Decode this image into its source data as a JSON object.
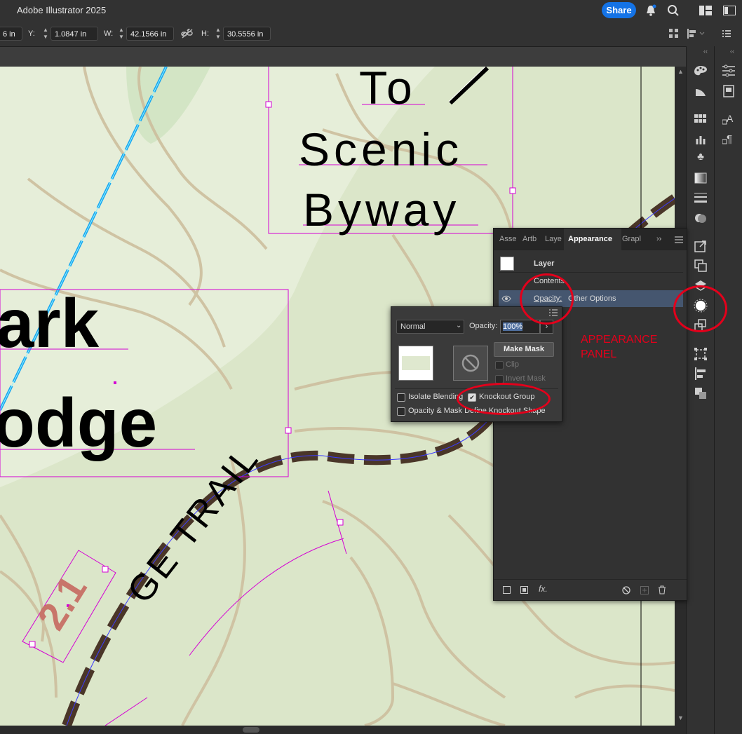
{
  "app": {
    "title": "Adobe Illustrator 2025"
  },
  "titlebar": {
    "share_label": "Share"
  },
  "control_bar": {
    "x_value": "6 in",
    "y_label": "Y:",
    "y_value": "1.0847 in",
    "w_label": "W:",
    "w_value": "42.1566 in",
    "h_label": "H:",
    "h_value": "30.5556 in"
  },
  "map": {
    "label_to": "To",
    "label_scenic": "Scenic",
    "label_byway": "Byway",
    "label_ark": "ark",
    "label_odge": "odge",
    "label_trail": "GE TRAIL",
    "label_number": "2.1"
  },
  "appearance_panel": {
    "tabs": [
      "Asse",
      "Artb",
      "Laye",
      "Appearance",
      "Grapl"
    ],
    "active_tab": "Appearance",
    "layer_label": "Layer",
    "contents_label": "Contents",
    "opacity_label": "Opacity:",
    "opacity_value": "Other Options"
  },
  "transparency_panel": {
    "blend_mode": "Normal",
    "opacity_label": "Opacity:",
    "opacity_value": "100%",
    "make_mask_label": "Make Mask",
    "clip_label": "Clip",
    "invert_mask_label": "Invert Mask",
    "isolate_blending_label": "Isolate Blending",
    "isolate_blending_checked": false,
    "knockout_group_label": "Knockout Group",
    "knockout_group_checked": true,
    "opacity_mask_label": "Opacity & Mask Define Knockout Shape",
    "opacity_mask_checked": false
  },
  "annotation": {
    "label": "APPEARANCE PANEL",
    "color": "#e3001b"
  },
  "colors": {
    "accent": "#1473e6",
    "map_bg": "#dbe6c9",
    "trail": "#4a3628",
    "selection": "#d400d4"
  }
}
